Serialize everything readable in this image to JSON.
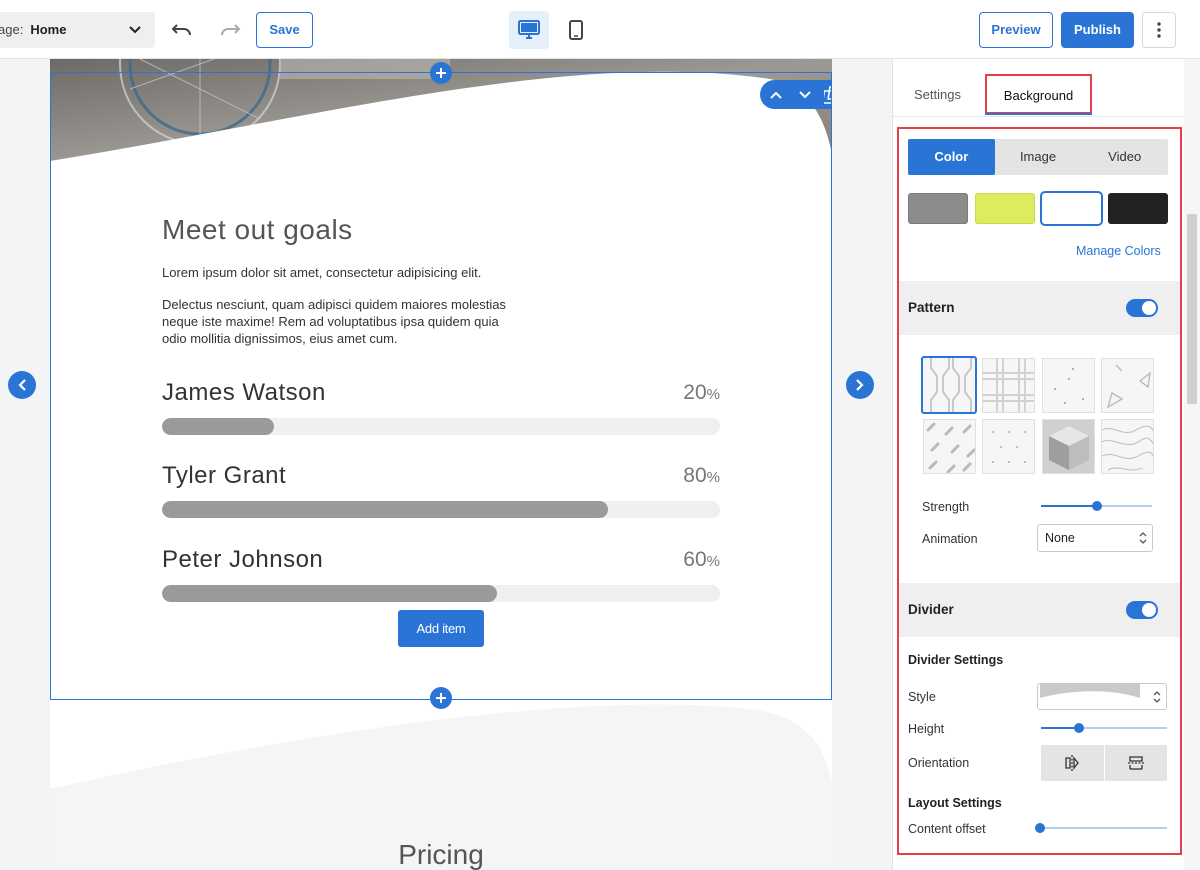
{
  "topbar": {
    "page_label": "age:",
    "page_value": "Home",
    "save_label": "Save",
    "preview_label": "Preview",
    "publish_label": "Publish",
    "icons": [
      "chevron-down-icon",
      "undo-icon",
      "redo-icon",
      "desktop-icon",
      "mobile-icon",
      "more-vertical-icon"
    ]
  },
  "canvas": {
    "section_toolbar_icons": [
      "move-up-icon",
      "move-down-icon",
      "duplicate-icon",
      "delete-icon"
    ],
    "title": "Meet out goals",
    "paragraph1": "Lorem ipsum dolor sit amet, consectetur adipisicing elit.",
    "paragraph2": "Delectus nesciunt, quam adipisci quidem maiores molestias neque iste maxime! Rem ad voluptatibus ipsa quidem quia odio mollitia dignissimos, eius amet cum.",
    "skills": [
      {
        "name": "James Watson",
        "percent": 20,
        "percent_text": "20",
        "unit": "%"
      },
      {
        "name": "Tyler Grant",
        "percent": 80,
        "percent_text": "80",
        "unit": "%"
      },
      {
        "name": "Peter Johnson",
        "percent": 60,
        "percent_text": "60",
        "unit": "%"
      }
    ],
    "add_item_label": "Add item",
    "next_section_title": "Pricing"
  },
  "panel": {
    "tabs": [
      "Settings",
      "Background"
    ],
    "active_tab": "Background",
    "bg_types": [
      "Color",
      "Image",
      "Video"
    ],
    "active_bg_type": "Color",
    "swatches": [
      "#8c8c8c",
      "#dcec5e",
      "#ffffff",
      "#222222"
    ],
    "selected_swatch": "#ffffff",
    "manage_colors_label": "Manage Colors",
    "pattern": {
      "title": "Pattern",
      "enabled": true,
      "strength_label": "Strength",
      "strength_value": 0.5,
      "animation_label": "Animation",
      "animation_value": "None"
    },
    "divider": {
      "title": "Divider",
      "enabled": true,
      "settings_title": "Divider Settings",
      "style_label": "Style",
      "height_label": "Height",
      "height_value": 0.3,
      "orientation_label": "Orientation",
      "layout_title": "Layout Settings",
      "offset_label": "Content offset",
      "offset_value": 0
    },
    "accent_color": "#2a74d6",
    "highlight_color": "#e53e4a"
  }
}
